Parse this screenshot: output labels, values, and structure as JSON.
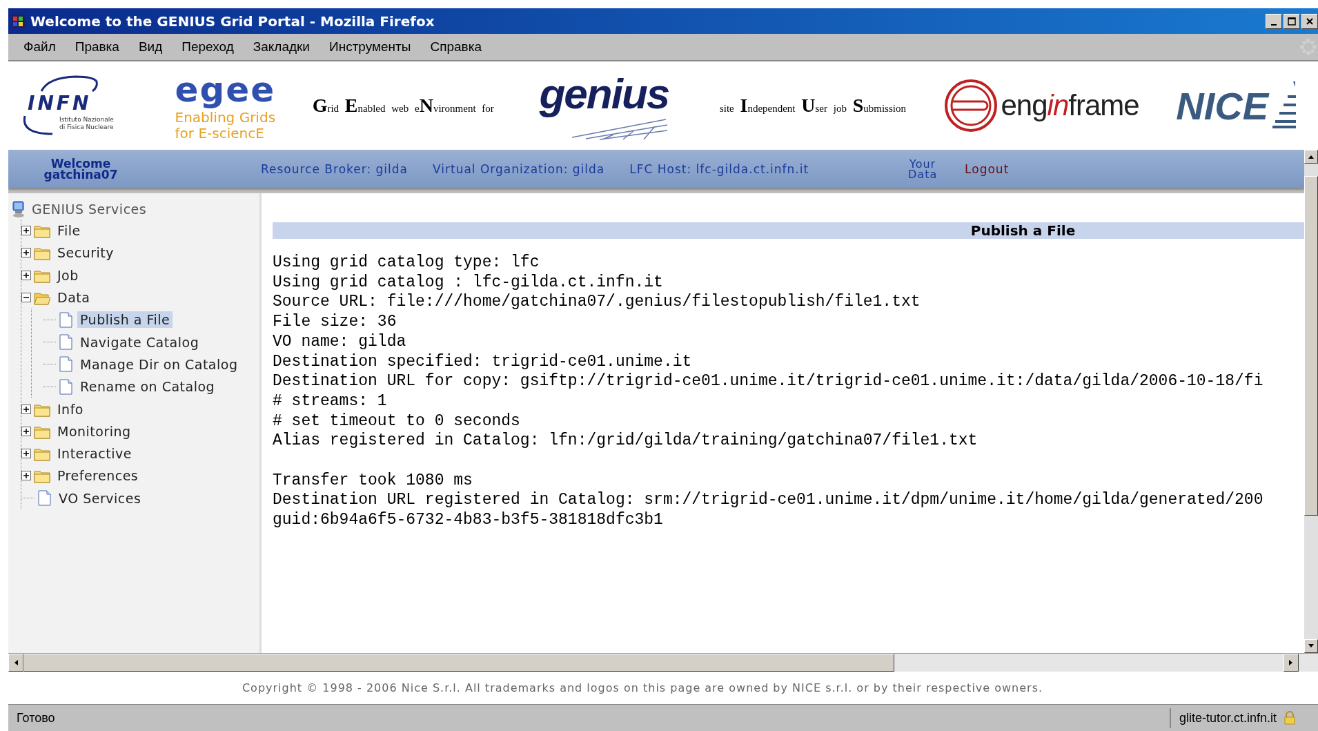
{
  "window": {
    "title": "Welcome to the GENIUS Grid Portal - Mozilla Firefox"
  },
  "menu_bar": [
    "Файл",
    "Правка",
    "Вид",
    "Переход",
    "Закладки",
    "Инструменты",
    "Справка"
  ],
  "banner": {
    "infn": {
      "name": "INFN",
      "subtitle": [
        "Istituto Nazionale",
        "di Fisica Nucleare"
      ]
    },
    "egee": {
      "name": "egee",
      "tagline": [
        "Enabling Grids",
        "for E-sciencE"
      ]
    },
    "genius_expansion": "**G**rid **E**nabled web e**N**vironment for",
    "genius": "genius",
    "site_expansion": "site **I**ndependent **U**ser job **S**ubmission",
    "enginframe": {
      "before": "eng",
      "accent": "in",
      "after": "frame"
    },
    "nice": "NICE"
  },
  "nav": [
    {
      "kind": "welcome",
      "text": "Welcome gatchina07"
    },
    {
      "kind": "info",
      "text": "Resource Broker: gilda"
    },
    {
      "kind": "info",
      "text": "Virtual Organization: gilda"
    },
    {
      "kind": "info",
      "text": "LFC Host: lfc-gilda.ct.infn.it"
    },
    {
      "kind": "data",
      "text": "Your Data"
    },
    {
      "kind": "logout",
      "text": "Logout"
    }
  ],
  "sidebar": {
    "root": "GENIUS Services",
    "items": [
      {
        "kind": "folder",
        "label": "File",
        "expanded": false,
        "selected": false
      },
      {
        "kind": "folder",
        "label": "Security",
        "expanded": false,
        "selected": false
      },
      {
        "kind": "folder",
        "label": "Job",
        "expanded": false,
        "selected": false
      },
      {
        "kind": "folder",
        "label": "Data",
        "expanded": true,
        "selected": false,
        "children": [
          {
            "kind": "document",
            "label": "Publish a File",
            "selected": true
          },
          {
            "kind": "document",
            "label": "Navigate Catalog",
            "selected": false
          },
          {
            "kind": "document",
            "label": "Manage Dir on Catalog",
            "selected": false
          },
          {
            "kind": "document",
            "label": "Rename on Catalog",
            "selected": false
          }
        ]
      },
      {
        "kind": "folder",
        "label": "Info",
        "expanded": false,
        "selected": false
      },
      {
        "kind": "folder",
        "label": "Monitoring",
        "expanded": false,
        "selected": false
      },
      {
        "kind": "folder",
        "label": "Interactive",
        "expanded": false,
        "selected": false
      },
      {
        "kind": "folder",
        "label": "Preferences",
        "expanded": false,
        "selected": false
      },
      {
        "kind": "document",
        "label": "VO Services",
        "selected": false
      }
    ]
  },
  "content": {
    "heading": "Publish a File",
    "blocks": [
      [
        "Using grid catalog type: lfc",
        "Using grid catalog : lfc-gilda.ct.infn.it",
        "Source URL: file:///home/gatchina07/.genius/filestopublish/file1.txt",
        "File size: 36",
        "VO name: gilda",
        "Destination specified: trigrid-ce01.unime.it",
        "Destination URL for copy: gsiftp://trigrid-ce01.unime.it/trigrid-ce01.unime.it:/data/gilda/2006-10-18/fi",
        "# streams: 1",
        "# set timeout to 0 seconds",
        "Alias registered in Catalog: lfn:/grid/gilda/training/gatchina07/file1.txt"
      ],
      [
        "Transfer took 1080 ms",
        "Destination URL registered in Catalog: srm://trigrid-ce01.unime.it/dpm/unime.it/home/gilda/generated/200",
        "guid:6b94a6f5-6732-4b83-b3f5-381818dfc3b1"
      ]
    ]
  },
  "footer": "Copyright © 1998 - 2006 Nice S.r.l. All trademarks and logos on this page are owned by NICE s.r.l. or by their respective owners.",
  "status_bar": {
    "text": "Готово",
    "host": "glite-tutor.ct.infn.it"
  }
}
